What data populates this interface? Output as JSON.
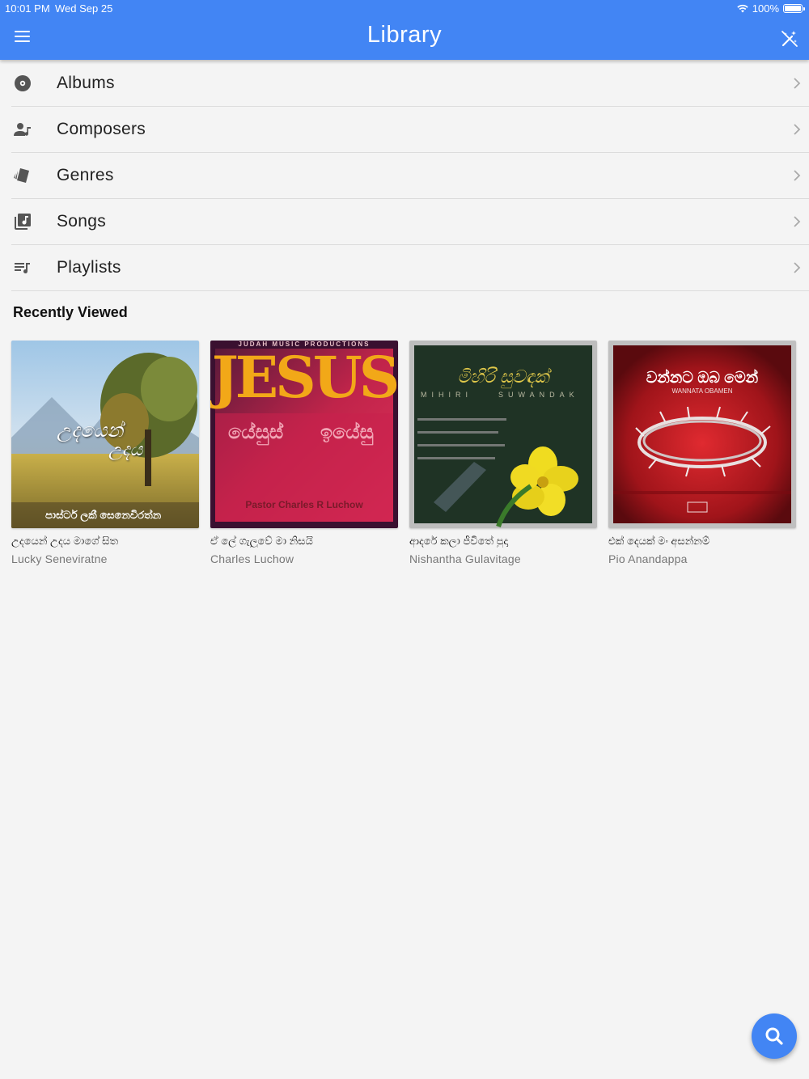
{
  "status_bar": {
    "time": "10:01 PM",
    "date": "Wed Sep 25",
    "battery": "100%",
    "battery_level": 1.0
  },
  "header": {
    "title": "Library",
    "menu_icon": "menu-icon",
    "action_icon": "magic-wand-off-icon"
  },
  "nav": {
    "items": [
      {
        "label": "Albums",
        "icon": "album-disc-icon"
      },
      {
        "label": "Composers",
        "icon": "composer-person-icon"
      },
      {
        "label": "Genres",
        "icon": "genres-cards-icon"
      },
      {
        "label": "Songs",
        "icon": "library-music-icon"
      },
      {
        "label": "Playlists",
        "icon": "playlist-icon"
      }
    ]
  },
  "recent": {
    "heading": "Recently Viewed",
    "cards": [
      {
        "title": "උදයෙන් උදය මාගේ සිත",
        "artist": "Lucky Seneviratne",
        "cover_text": [
          "උදයෙන්",
          "උදය",
          "පාස්ටර් ලකී සෙනෙවිරත්න"
        ]
      },
      {
        "title": "ඒ ලේ ගැලුවේ මා නිසයි",
        "artist": "Charles Luchow",
        "cover_text": [
          "JUDAH MUSIC PRODUCTIONS",
          "JESUS",
          "යේසුස්",
          "ඉයේසු",
          "Pastor Charles R Luchow"
        ]
      },
      {
        "title": "ආදරේ කලා ජීවිතේ පුදා",
        "artist": "Nishantha Gulavitage",
        "cover_text": [
          "මිහිරි සුවඳක්",
          "MIHIRI",
          "SUWANDAK"
        ]
      },
      {
        "title": "එක් දෙයක් මං අසන්නම්",
        "artist": "Pio Anandappa",
        "cover_text": [
          "වන්නට ඔබ මෙන්",
          "WANNATA OBAMEN"
        ]
      }
    ]
  },
  "fab": {
    "icon": "search-icon"
  },
  "colors": {
    "primary": "#4285f4",
    "background": "#f4f4f4"
  }
}
